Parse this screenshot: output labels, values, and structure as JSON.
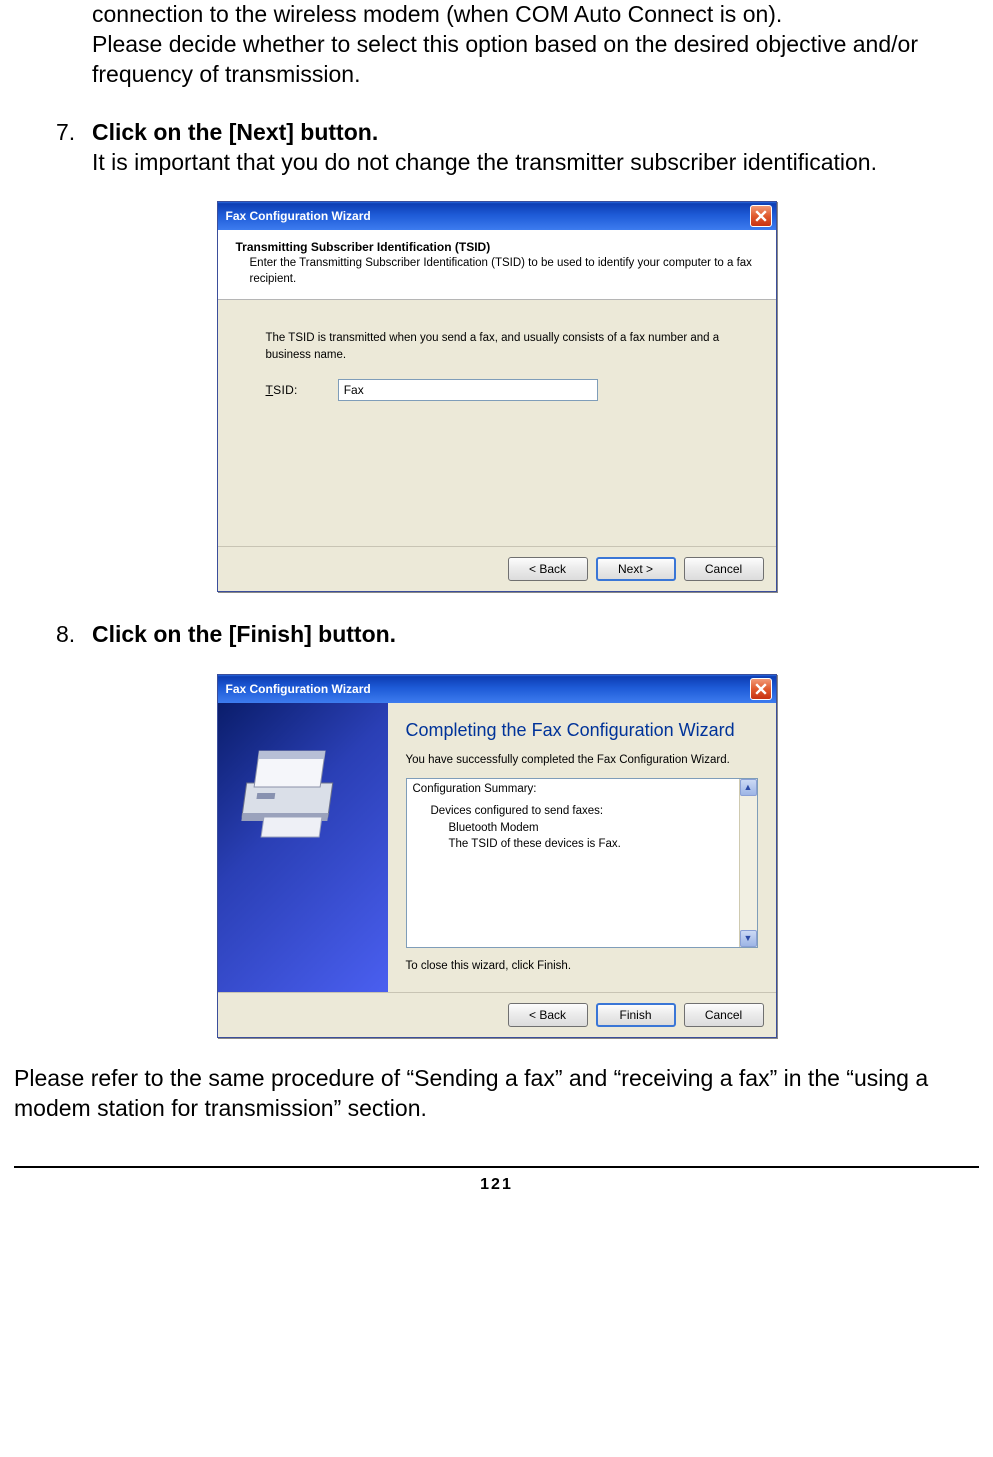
{
  "intro": {
    "line1": "connection to the wireless modem (when COM Auto Connect is on).",
    "line2": "Please decide whether to select this option based on the desired objective and/or frequency of transmission."
  },
  "step7": {
    "num": "7.",
    "title": "Click on the [Next] button.",
    "note": "It is important that you do not change the transmitter subscriber identification."
  },
  "dialog1": {
    "titlebar": "Fax Configuration Wizard",
    "header_title": "Transmitting Subscriber Identification (TSID)",
    "header_desc": "Enter the Transmitting Subscriber Identification (TSID) to be used to identify your computer to a fax recipient.",
    "body_note": "The TSID is transmitted when you send a fax, and usually consists of a fax number and a business name.",
    "tsid_label_prefix": "T",
    "tsid_label_rest": "SID:",
    "tsid_value": "Fax",
    "btn_back": "< Back",
    "btn_next": "Next >",
    "btn_cancel": "Cancel"
  },
  "step8": {
    "num": "8.",
    "title": "Click on the [Finish] button."
  },
  "dialog2": {
    "titlebar": "Fax Configuration Wizard",
    "big_title": "Completing the Fax Configuration Wizard",
    "para1": "You have successfully completed the Fax Configuration Wizard.",
    "summary_label": "Configuration Summary:",
    "summary_line1": "Devices configured to send faxes:",
    "summary_line2": "Bluetooth Modem",
    "summary_line3": "The TSID of these devices is Fax.",
    "close_hint": "To close this wizard, click Finish.",
    "btn_back": "< Back",
    "btn_finish": "Finish",
    "btn_cancel": "Cancel"
  },
  "outro": "Please refer to the same procedure of “Sending a fax” and “receiving a fax” in the “using a modem station for transmission” section.",
  "pagenum": "121"
}
